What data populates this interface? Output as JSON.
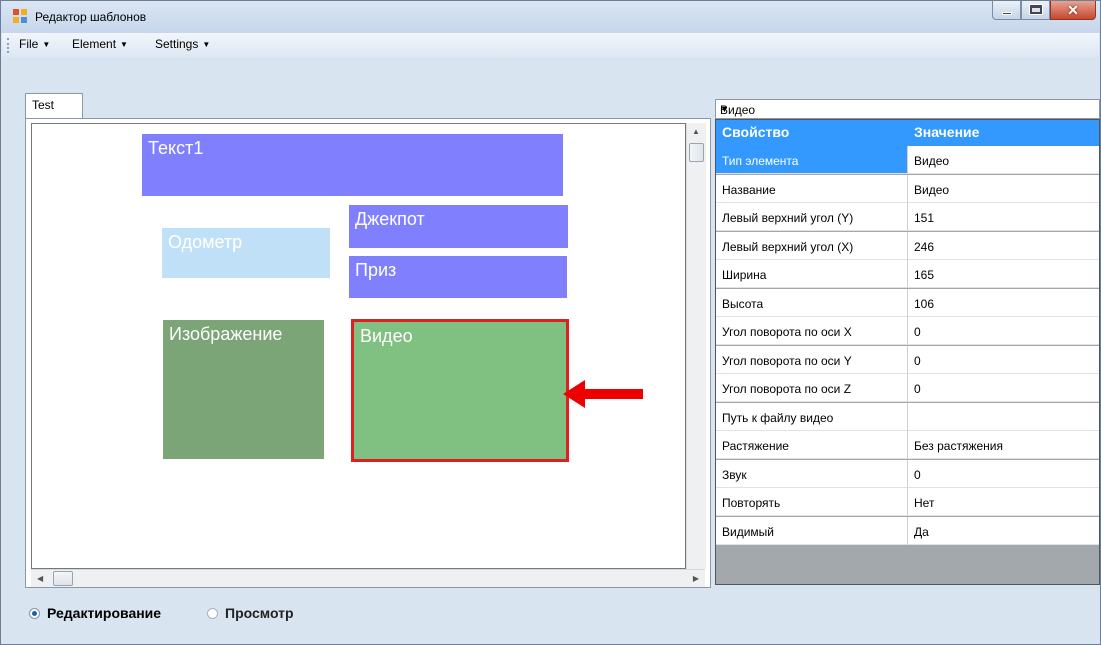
{
  "window": {
    "title": "Редактор шаблонов",
    "buttons": [
      "minimize",
      "maximize",
      "close"
    ]
  },
  "menu": {
    "items": [
      {
        "label": "File"
      },
      {
        "label": "Element"
      },
      {
        "label": "Settings"
      }
    ]
  },
  "tabs": [
    {
      "label": "Test"
    }
  ],
  "canvas": {
    "elements": {
      "text1": {
        "label": "Текст1",
        "color": "#8080ff"
      },
      "odometer": {
        "label": "Одометр",
        "color": "#c0e0f8"
      },
      "jackpot": {
        "label": "Джекпот",
        "color": "#8080ff"
      },
      "prize": {
        "label": "Приз",
        "color": "#8080ff"
      },
      "image": {
        "label": "Изображение",
        "color": "#7ba577"
      },
      "video": {
        "label": "Видео",
        "color": "#80c080",
        "selected": true
      }
    },
    "annotation": {
      "type": "red-arrow",
      "color": "#ff0000"
    }
  },
  "properties": {
    "selected_object": "Видео",
    "header": {
      "property": "Свойство",
      "value": "Значение"
    },
    "rows": [
      {
        "name": "Тип элемента",
        "value": "Видео",
        "selected": true
      },
      {
        "name": "Название",
        "value": "Видео"
      },
      {
        "name": "Левый верхний угол (Y)",
        "value": "151"
      },
      {
        "name": "Левый верхний угол (X)",
        "value": "246"
      },
      {
        "name": "Ширина",
        "value": "165"
      },
      {
        "name": "Высота",
        "value": "106"
      },
      {
        "name": "Угол поворота по оси X",
        "value": "0"
      },
      {
        "name": "Угол поворота по оси Y",
        "value": "0"
      },
      {
        "name": "Угол поворота по оси Z",
        "value": "0"
      },
      {
        "name": "Путь к файлу видео",
        "value": ""
      },
      {
        "name": "Растяжение",
        "value": "Без растяжения"
      },
      {
        "name": "Звук",
        "value": "0"
      },
      {
        "name": "Повторять",
        "value": "Нет"
      },
      {
        "name": "Видимый",
        "value": "Да"
      }
    ]
  },
  "mode": {
    "options": [
      {
        "label": "Редактирование",
        "checked": true
      },
      {
        "label": "Просмотр",
        "checked": false
      }
    ]
  },
  "colors": {
    "accent": "#3399ff",
    "selection_border": "#e02020"
  }
}
